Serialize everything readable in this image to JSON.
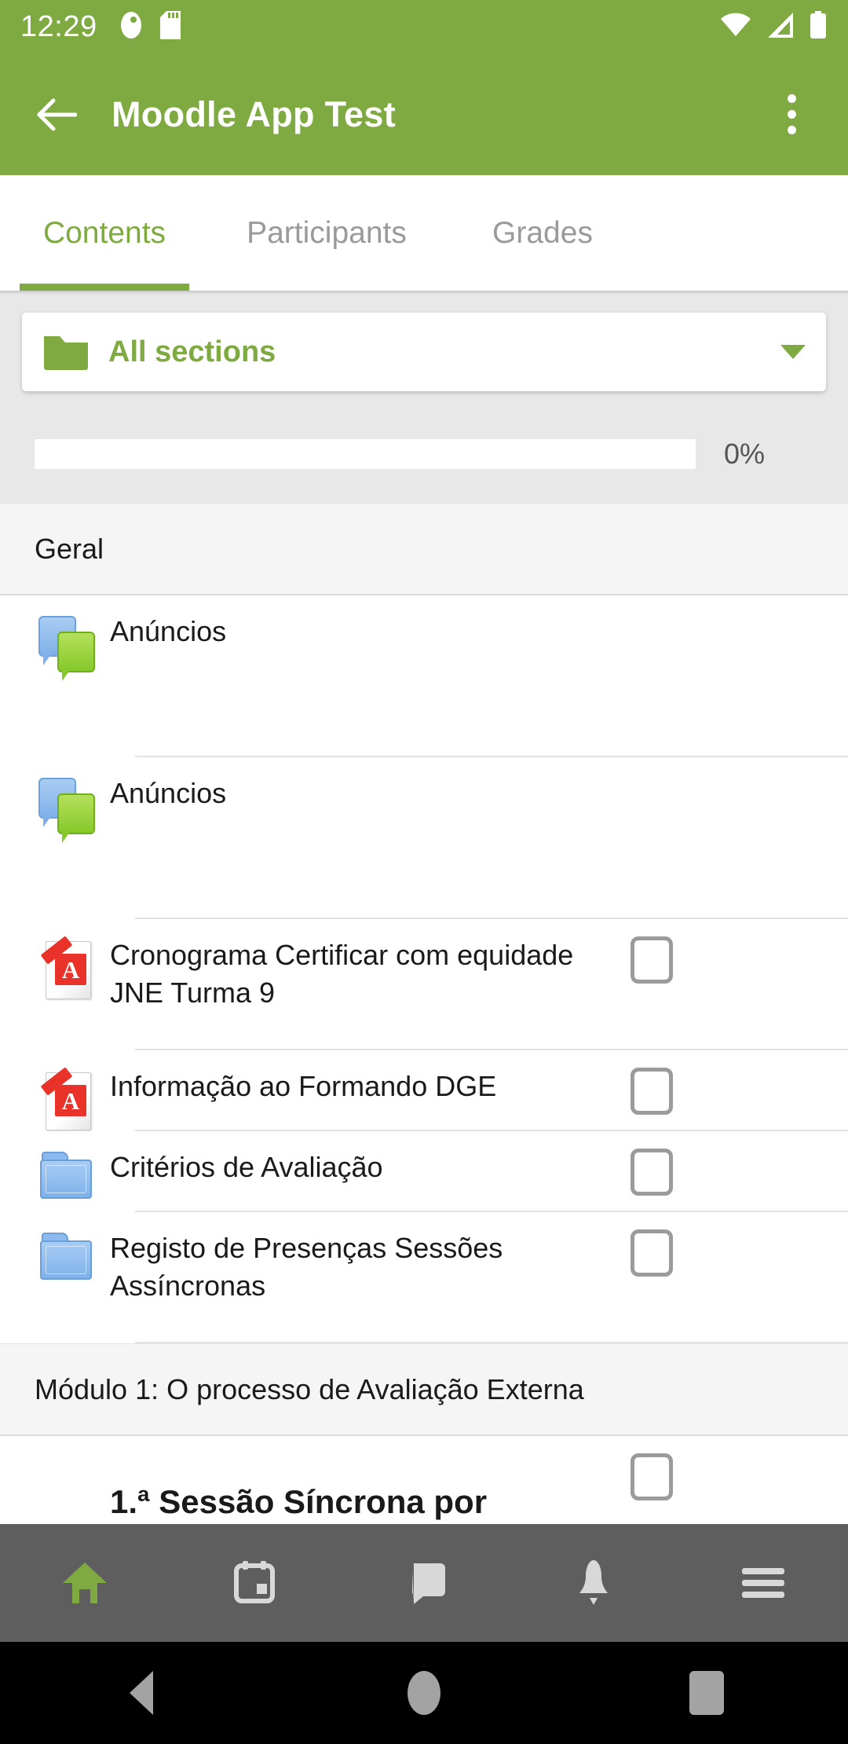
{
  "status_bar": {
    "time": "12:29",
    "icons": [
      "camera-privacy-icon",
      "sd-card-icon",
      "wifi-icon",
      "cellular-signal-icon",
      "battery-icon"
    ]
  },
  "app_bar": {
    "back_icon": "back-arrow-icon",
    "title": "Moodle App Test",
    "overflow_icon": "overflow-menu-icon"
  },
  "tabs": [
    {
      "label": "Contents",
      "active": true
    },
    {
      "label": "Participants",
      "active": false
    },
    {
      "label": "Grades",
      "active": false
    }
  ],
  "section_selector": {
    "icon": "folder-icon",
    "label": "All sections",
    "caret_icon": "chevron-down-icon"
  },
  "progress": {
    "percent_label": "0%",
    "value": 0
  },
  "sections": [
    {
      "header": "Geral",
      "items": [
        {
          "title": "Anúncios",
          "icon": "forum-icon",
          "checkbox": false
        },
        {
          "title": "Anúncios",
          "icon": "forum-icon",
          "checkbox": false
        },
        {
          "title": "Cronograma Certificar com equidade JNE Turma 9",
          "icon": "pdf-file-icon",
          "checkbox": true
        },
        {
          "title": "Informação ao Formando DGE",
          "icon": "pdf-file-icon",
          "checkbox": true
        },
        {
          "title": "Critérios de Avaliação",
          "icon": "folder-icon",
          "checkbox": true
        },
        {
          "title": "Registo de Presenças Sessões Assíncronas",
          "icon": "folder-icon",
          "checkbox": true
        }
      ]
    },
    {
      "header": "Módulo 1: O processo de Avaliação Externa",
      "items": [
        {
          "title": "1.ª Sessão Síncrona por",
          "icon": "none",
          "checkbox": true,
          "bold": true
        }
      ]
    }
  ],
  "bottom_nav": [
    {
      "icon": "home-icon",
      "active": true
    },
    {
      "icon": "calendar-icon",
      "active": false
    },
    {
      "icon": "messages-icon",
      "active": false
    },
    {
      "icon": "notifications-bell-icon",
      "active": false
    },
    {
      "icon": "hamburger-menu-icon",
      "active": false
    }
  ],
  "android_nav": [
    {
      "icon": "android-back-icon"
    },
    {
      "icon": "android-home-icon"
    },
    {
      "icon": "android-recents-icon"
    }
  ],
  "colors": {
    "brand_green": "#7fa941",
    "accent_green": "#86c92a",
    "panel_gray": "#e8e8e8",
    "section_gray": "#f5f5f5",
    "bottom_nav_gray": "#5e5e5e",
    "text_dark": "#1a1a1a",
    "text_muted": "#9a9a9a"
  }
}
